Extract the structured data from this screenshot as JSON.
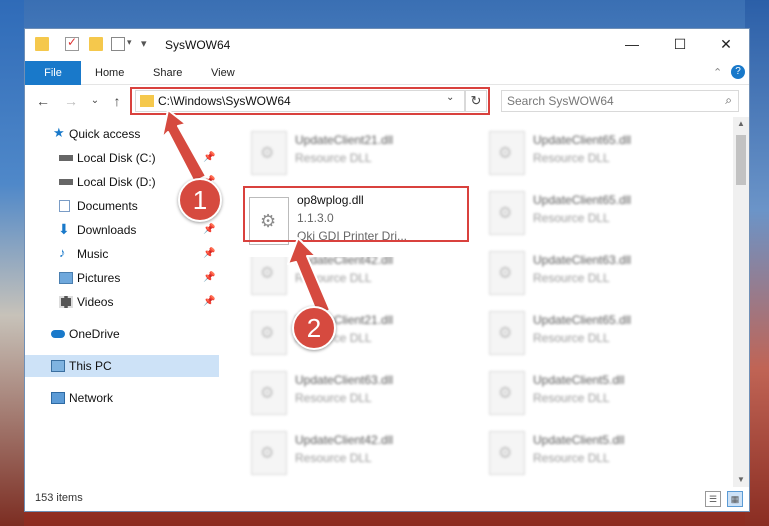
{
  "window": {
    "title": "SysWOW64",
    "minimize": "—",
    "maximize": "☐",
    "close": "✕"
  },
  "quickaccess": {
    "dropdown": "▾"
  },
  "ribbon": {
    "tabs": [
      "File",
      "Home",
      "Share",
      "View"
    ],
    "collapse_icon": "chevron-down-icon",
    "help_icon": "help-icon"
  },
  "address": {
    "path": "C:\\Windows\\SysWOW64",
    "dropdown": "⌄",
    "refresh": "↻",
    "back": "←",
    "forward": "→",
    "recent": "⌄",
    "up": "↑"
  },
  "search": {
    "placeholder": "Search SysWOW64",
    "icon": "⌕"
  },
  "nav": {
    "items": [
      {
        "label": "Quick access",
        "icon": "star-icon"
      },
      {
        "label": "Local Disk (C:)",
        "icon": "drive-icon",
        "pinned": true
      },
      {
        "label": "Local Disk (D:)",
        "icon": "drive-icon",
        "pinned": true
      },
      {
        "label": "Documents",
        "icon": "documents-icon",
        "pinned": true
      },
      {
        "label": "Downloads",
        "icon": "download-icon",
        "pinned": true
      },
      {
        "label": "Music",
        "icon": "music-icon",
        "pinned": true
      },
      {
        "label": "Pictures",
        "icon": "pictures-icon",
        "pinned": true
      },
      {
        "label": "Videos",
        "icon": "videos-icon",
        "pinned": true
      },
      {
        "label": "OneDrive",
        "icon": "cloud-icon"
      },
      {
        "label": "This PC",
        "icon": "computer-icon",
        "selected": true
      },
      {
        "label": "Network",
        "icon": "network-icon"
      }
    ],
    "pin_glyph": "📌"
  },
  "files": {
    "blurred": [
      {
        "name": "UpdateClient21.dll",
        "sub": "Resource DLL"
      },
      {
        "name": "UpdateClient65.dll",
        "sub": "Resource DLL"
      },
      {
        "name": "UpdateClient65.dll",
        "sub": "Resource DLL"
      },
      {
        "name": "UpdateClient42.dll",
        "sub": "Resource DLL"
      },
      {
        "name": "UpdateClient63.dll",
        "sub": "Resource DLL"
      },
      {
        "name": "UpdateClient21.dll",
        "sub": "Resource DLL"
      },
      {
        "name": "UpdateClient65.dll",
        "sub": "Resource DLL"
      },
      {
        "name": "UpdateClient63.dll",
        "sub": "Resource DLL"
      },
      {
        "name": "UpdateClient5.dll",
        "sub": "Resource DLL"
      },
      {
        "name": "UpdateClient42.dll",
        "sub": "Resource DLL"
      },
      {
        "name": "UpdateClient5.dll",
        "sub": "Resource DLL"
      }
    ],
    "target": {
      "name": "op8wplog.dll",
      "version": "1.1.3.0",
      "description": "Oki GDI Printer Dri..."
    }
  },
  "status": {
    "count": "153 items"
  },
  "callouts": [
    "1",
    "2"
  ],
  "colors": {
    "highlight": "#d9413d",
    "accent": "#1979ca",
    "callout": "#d64a3f"
  }
}
